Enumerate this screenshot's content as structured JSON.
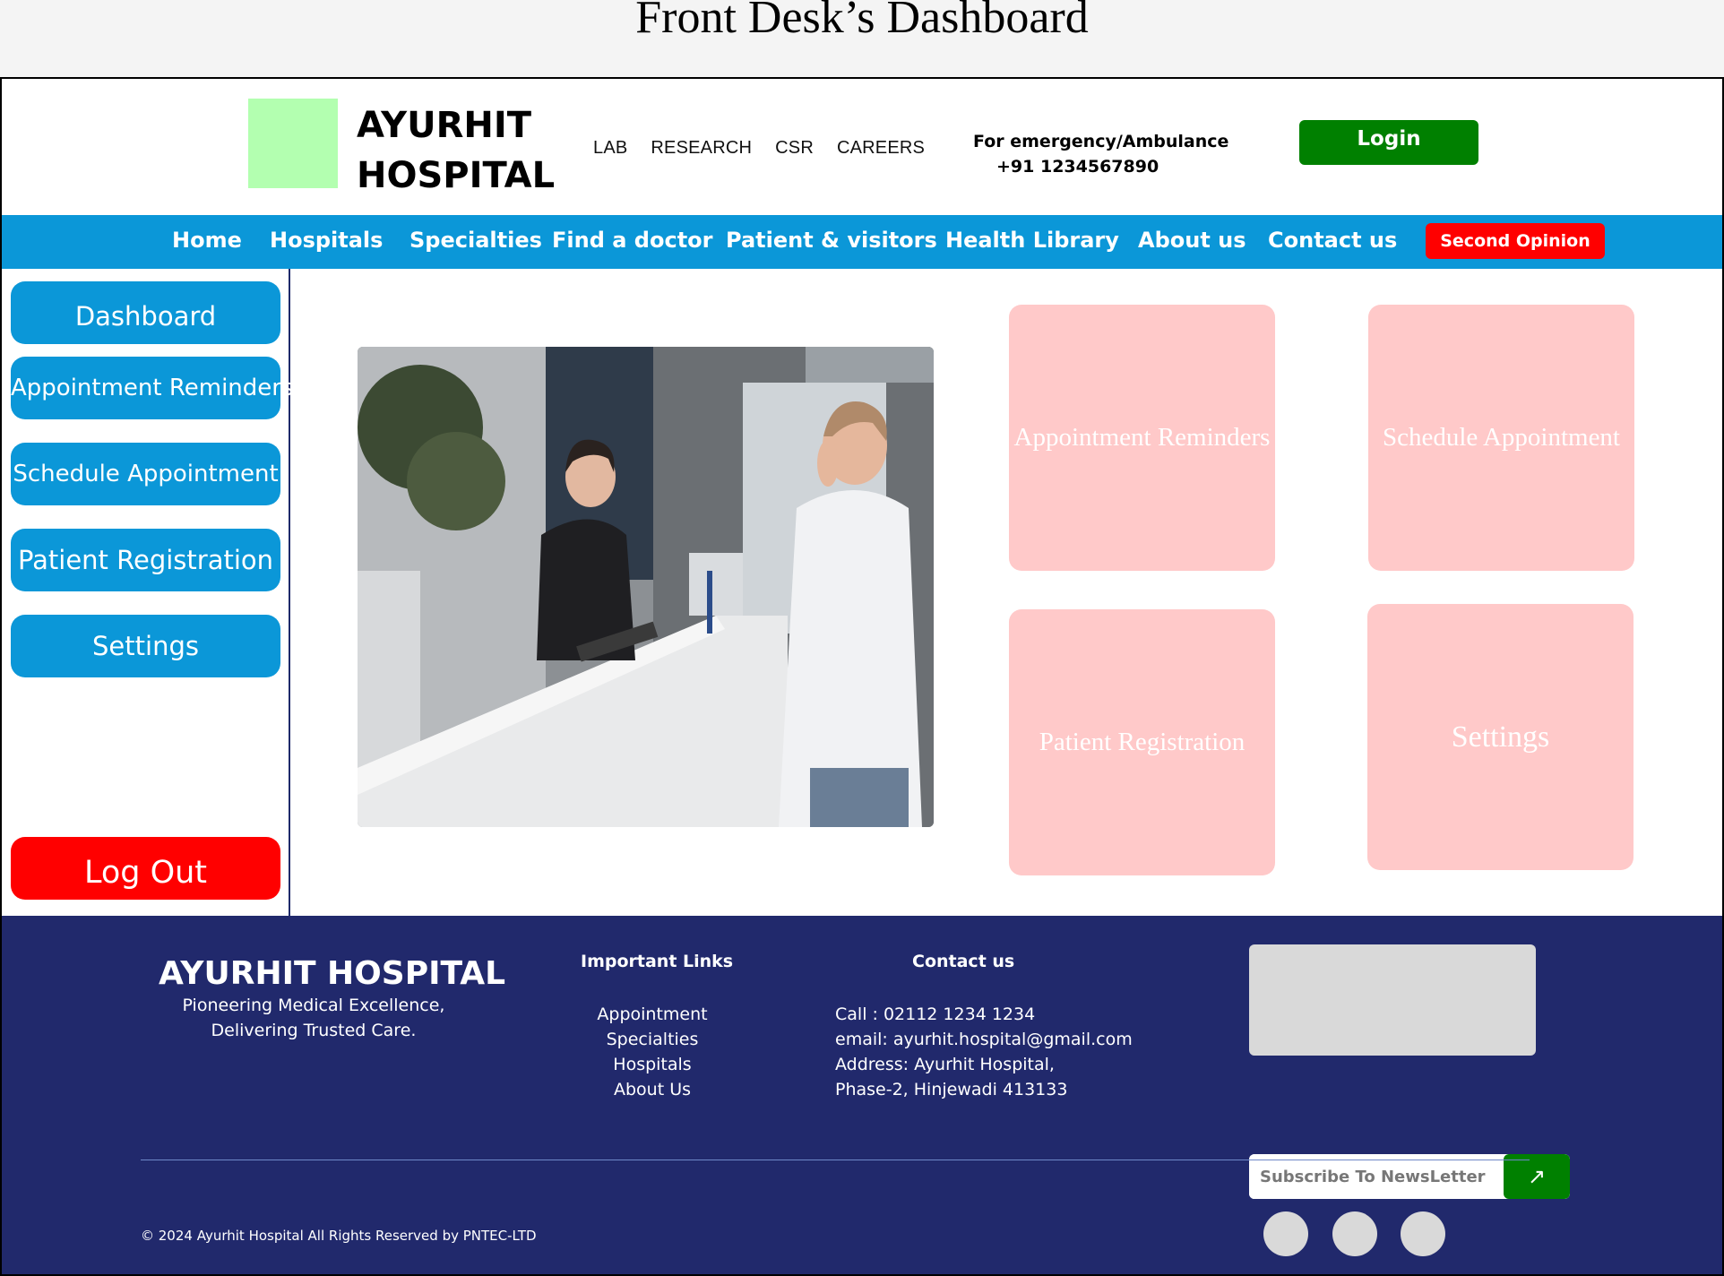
{
  "page_title": "Front Desk’s Dashboard",
  "header": {
    "brand_line1": "AYURHIT",
    "brand_line2": "HOSPITAL",
    "top_links": [
      "LAB",
      "RESEARCH",
      "CSR",
      "CAREERS"
    ],
    "emergency_label": "For emergency/Ambulance",
    "emergency_phone": "+91 1234567890",
    "login_label": "Login"
  },
  "nav": {
    "items": [
      "Home",
      "Hospitals",
      "Specialties",
      "Find a doctor",
      "Patient & visitors",
      "Health Library",
      "About us",
      "Contact us"
    ],
    "cta_label": "Second Opinion"
  },
  "sidebar": {
    "items": [
      "Dashboard",
      "Appointment Reminders",
      "Schedule Appointment",
      "Patient Registration",
      "Settings"
    ],
    "logout_label": "Log Out"
  },
  "main": {
    "tiles": [
      "Appointment Reminders",
      "Schedule Appointment",
      "Patient Registration",
      "Settings"
    ]
  },
  "footer": {
    "brand": "AYURHIT HOSPITAL",
    "tagline_line1": "Pioneering Medical Excellence,",
    "tagline_line2": "Delivering Trusted Care.",
    "links_heading": "Important Links",
    "links": [
      "Appointment",
      "Specialties",
      "Hospitals",
      "About Us"
    ],
    "contact_heading": "Contact us",
    "contact_call": "Call : 02112 1234 1234",
    "contact_email": "email: ayurhit.hospital@gmail.com",
    "contact_address1": "Address: Ayurhit Hospital,",
    "contact_address2": "Phase-2, Hinjewadi 413133",
    "newsletter_placeholder": "Subscribe To NewsLetter",
    "newsletter_icon": "arrow-up-right-icon",
    "copyright": "© 2024 Ayurhit Hospital All Rights Reserved by PNTEC-LTD"
  },
  "colors": {
    "nav_blue": "#0b97d8",
    "login_green": "#008000",
    "danger_red": "#ff0000",
    "tile_pink": "#ffc9c9",
    "footer_navy": "#21296c",
    "logo_green": "#b3ffb0"
  }
}
